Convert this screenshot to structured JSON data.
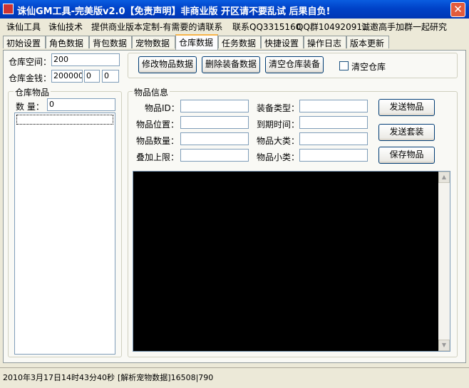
{
  "window": {
    "title": "诛仙GM工具-完美版v2.0【免责声明】非商业版 开区请不要乱试 后果自负!",
    "close_glyph": "✕"
  },
  "menu": {
    "items": [
      "诛仙工具",
      "诛仙技术",
      "提供商业版本定制-有需要的请联系",
      "联系QQ3315160",
      "QQ群104920911",
      "诚邀高手加群一起研究"
    ]
  },
  "tabs": [
    "初始设置",
    "角色数据",
    "背包数据",
    "宠物数据",
    "仓库数据",
    "任务数据",
    "快捷设置",
    "操作日志",
    "版本更新"
  ],
  "warehouse": {
    "space_label": "仓库空间：",
    "space_value": "200",
    "money_label": "仓库金钱：",
    "money_value": "200000",
    "money_value2": "0",
    "money_value3": "0",
    "buttons": {
      "modify": "修改物品数据",
      "delete_equip": "删除装备数据",
      "clear_equip": "清空仓库装备"
    },
    "clear_label": "清空仓库"
  },
  "items_group": {
    "title": "仓库物品",
    "count_label": "数 量：",
    "count_value": "0"
  },
  "info_group": {
    "title": "物品信息",
    "id_label": "物品ID：",
    "pos_label": "物品位置：",
    "qty_label": "物品数量：",
    "stack_label": "叠加上限：",
    "equip_type_label": "装备类型：",
    "expire_label": "到期时间：",
    "major_label": "物品大类：",
    "minor_label": "物品小类：",
    "send_item": "发送物品",
    "send_set": "发送套装",
    "save_item": "保存物品"
  },
  "status": {
    "datetime": "2010年3月17日14时43分40秒",
    "message": "[解析宠物数据]16508|790"
  },
  "icons": {
    "scroll_up": "▲",
    "scroll_down": "▼"
  }
}
